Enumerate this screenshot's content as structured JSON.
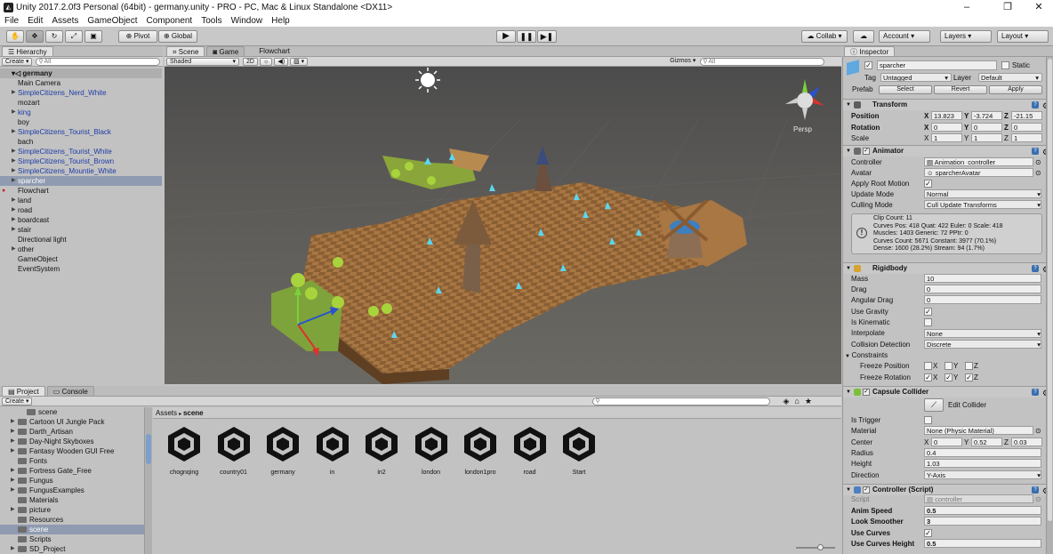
{
  "window": {
    "title": "Unity 2017.2.0f3 Personal (64bit) - germany.unity - PRO - PC, Mac & Linux Standalone <DX11>",
    "controls": [
      "–",
      "❐",
      "✕"
    ]
  },
  "menu": [
    "File",
    "Edit",
    "Assets",
    "GameObject",
    "Component",
    "Tools",
    "Window",
    "Help"
  ],
  "toolbar": {
    "tools": [
      "hand-icon",
      "move-icon",
      "rotate-icon",
      "scale-icon",
      "rect-icon"
    ],
    "pivot": "Pivot",
    "global": "Global",
    "collab": "Collab ▾",
    "account": "Account",
    "layers": "Layers",
    "layout": "Layout"
  },
  "hierarchy": {
    "tab": "Hierarchy",
    "create": "Create",
    "search_placeholder": "All",
    "root": "germany",
    "items": [
      {
        "label": "Main Camera",
        "color": "black",
        "arrow": false
      },
      {
        "label": "SimpleCitizens_Nerd_White",
        "color": "blue",
        "arrow": true
      },
      {
        "label": "mozart",
        "color": "black",
        "arrow": false
      },
      {
        "label": "king",
        "color": "blue",
        "arrow": true
      },
      {
        "label": "boy",
        "color": "black",
        "arrow": false
      },
      {
        "label": "SimpleCitizens_Tourist_Black",
        "color": "blue",
        "arrow": true
      },
      {
        "label": "bach",
        "color": "black",
        "arrow": false
      },
      {
        "label": "SimpleCitizens_Tourist_White",
        "color": "blue",
        "arrow": true
      },
      {
        "label": "SimpleCitizens_Tourist_Brown",
        "color": "blue",
        "arrow": true
      },
      {
        "label": "SimpleCitizens_Mountie_White",
        "color": "blue",
        "arrow": true
      },
      {
        "label": "sparcher",
        "color": "selected",
        "arrow": true
      },
      {
        "label": "Flowchart",
        "color": "black",
        "arrow": false
      },
      {
        "label": "land",
        "color": "black",
        "arrow": true
      },
      {
        "label": "road",
        "color": "black",
        "arrow": true
      },
      {
        "label": "boardcast",
        "color": "black",
        "arrow": true
      },
      {
        "label": "stair",
        "color": "black",
        "arrow": true
      },
      {
        "label": "Directional light",
        "color": "black",
        "arrow": false
      },
      {
        "label": "other",
        "color": "black",
        "arrow": true
      },
      {
        "label": "GameObject",
        "color": "black",
        "arrow": false
      },
      {
        "label": "EventSystem",
        "color": "black",
        "arrow": false
      }
    ]
  },
  "scene_view": {
    "tabs": [
      "Scene",
      "Game",
      "Flowchart"
    ],
    "shading": "Shaded",
    "mode_2d": "2D",
    "gizmos": "Gizmos",
    "search_placeholder": "All",
    "persp_label": "Persp"
  },
  "inspector": {
    "tab": "Inspector",
    "object_name": "sparcher",
    "static_label": "Static",
    "tag_label": "Tag",
    "tag_value": "Untagged",
    "layer_label": "Layer",
    "layer_value": "Default",
    "prefab_label": "Prefab",
    "prefab_buttons": [
      "Select",
      "Revert",
      "Apply"
    ],
    "transform": {
      "title": "Transform",
      "position": {
        "label": "Position",
        "x": "13.823",
        "y": "-3.724",
        "z": "-21.15"
      },
      "rotation": {
        "label": "Rotation",
        "x": "0",
        "y": "0",
        "z": "0"
      },
      "scale": {
        "label": "Scale",
        "x": "1",
        "y": "1",
        "z": "1"
      }
    },
    "animator": {
      "title": "Animator",
      "controller_label": "Controller",
      "controller_value": "Animation_controller",
      "avatar_label": "Avatar",
      "avatar_value": "sparcherAvatar",
      "apply_root_label": "Apply Root Motion",
      "update_mode_label": "Update Mode",
      "update_mode_value": "Normal",
      "culling_label": "Culling Mode",
      "culling_value": "Cull Update Transforms",
      "info": [
        "Clip Count: 11",
        "Curves Pos: 418 Quat: 422 Euler: 0 Scale: 418",
        "Muscles: 1403 Generic: 72 PPtr: 0",
        "Curves Count: 5671 Constant: 3977 (70.1%)",
        "Dense: 1600 (28.2%) Stream: 94 (1.7%)"
      ]
    },
    "rigidbody": {
      "title": "Rigidbody",
      "mass_label": "Mass",
      "mass": "10",
      "drag_label": "Drag",
      "drag": "0",
      "angular_label": "Angular Drag",
      "angular": "0",
      "gravity_label": "Use Gravity",
      "kinematic_label": "Is Kinematic",
      "interpolate_label": "Interpolate",
      "interpolate": "None",
      "collision_label": "Collision Detection",
      "collision": "Discrete",
      "constraints_label": "Constraints",
      "freeze_pos_label": "Freeze Position",
      "freeze_rot_label": "Freeze Rotation",
      "axes": [
        "X",
        "Y",
        "Z"
      ]
    },
    "capsule": {
      "title": "Capsule Collider",
      "edit_label": "Edit Collider",
      "trigger_label": "Is Trigger",
      "material_label": "Material",
      "material": "None (Physic Material)",
      "center_label": "Center",
      "cx": "0",
      "cy": "0.52",
      "cz": "0.03",
      "radius_label": "Radius",
      "radius": "0.4",
      "height_label": "Height",
      "height": "1.03",
      "direction_label": "Direction",
      "direction": "Y-Axis"
    },
    "script": {
      "title": "Controller (Script)",
      "script_label": "Script",
      "script": "controller",
      "anim_speed_label": "Anim Speed",
      "anim_speed": "0.5",
      "look_label": "Look Smoother",
      "look": "3",
      "curves_label": "Use Curves",
      "curves_height_label": "Use Curves Height",
      "curves_height": "0.5"
    }
  },
  "project": {
    "tabs": [
      "Project",
      "Console"
    ],
    "create": "Create",
    "breadcrumb": [
      "Assets",
      "scene"
    ],
    "folders": [
      {
        "label": "scene",
        "indent": 1,
        "arrow": false,
        "sel": false
      },
      {
        "label": "Cartoon UI Jungle Pack",
        "indent": 0,
        "arrow": true,
        "sel": false
      },
      {
        "label": "Darth_Artisan",
        "indent": 0,
        "arrow": true,
        "sel": false
      },
      {
        "label": "Day-Night Skyboxes",
        "indent": 0,
        "arrow": true,
        "sel": false
      },
      {
        "label": "Fantasy Wooden GUI  Free",
        "indent": 0,
        "arrow": true,
        "sel": false
      },
      {
        "label": "Fonts",
        "indent": 0,
        "arrow": false,
        "sel": false
      },
      {
        "label": "Fortress Gate_Free",
        "indent": 0,
        "arrow": true,
        "sel": false
      },
      {
        "label": "Fungus",
        "indent": 0,
        "arrow": true,
        "sel": false
      },
      {
        "label": "FungusExamples",
        "indent": 0,
        "arrow": true,
        "sel": false
      },
      {
        "label": "Materials",
        "indent": 0,
        "arrow": false,
        "sel": false
      },
      {
        "label": "picture",
        "indent": 0,
        "arrow": true,
        "sel": false
      },
      {
        "label": "Resources",
        "indent": 0,
        "arrow": false,
        "sel": false
      },
      {
        "label": "scene",
        "indent": 0,
        "arrow": false,
        "sel": true
      },
      {
        "label": "Scripts",
        "indent": 0,
        "arrow": false,
        "sel": false
      },
      {
        "label": "SD_Project",
        "indent": 0,
        "arrow": true,
        "sel": false
      }
    ],
    "assets": [
      "chognqing",
      "country01",
      "germany",
      "in",
      "in2",
      "london",
      "london1pro",
      "road",
      "Start"
    ]
  }
}
